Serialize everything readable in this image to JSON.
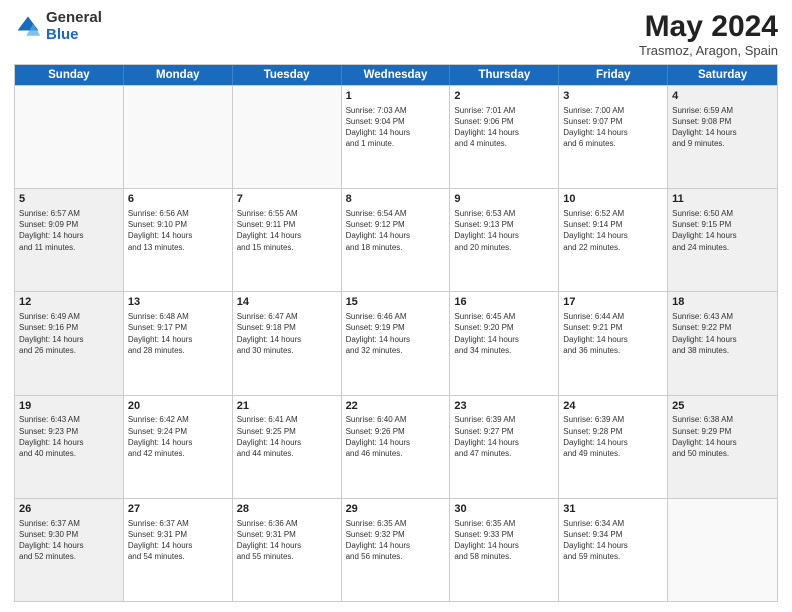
{
  "logo": {
    "general": "General",
    "blue": "Blue"
  },
  "header": {
    "month": "May 2024",
    "location": "Trasmoz, Aragon, Spain"
  },
  "days": [
    "Sunday",
    "Monday",
    "Tuesday",
    "Wednesday",
    "Thursday",
    "Friday",
    "Saturday"
  ],
  "weeks": [
    [
      {
        "day": "",
        "info": ""
      },
      {
        "day": "",
        "info": ""
      },
      {
        "day": "",
        "info": ""
      },
      {
        "day": "1",
        "info": "Sunrise: 7:03 AM\nSunset: 9:04 PM\nDaylight: 14 hours\nand 1 minute."
      },
      {
        "day": "2",
        "info": "Sunrise: 7:01 AM\nSunset: 9:06 PM\nDaylight: 14 hours\nand 4 minutes."
      },
      {
        "day": "3",
        "info": "Sunrise: 7:00 AM\nSunset: 9:07 PM\nDaylight: 14 hours\nand 6 minutes."
      },
      {
        "day": "4",
        "info": "Sunrise: 6:59 AM\nSunset: 9:08 PM\nDaylight: 14 hours\nand 9 minutes."
      }
    ],
    [
      {
        "day": "5",
        "info": "Sunrise: 6:57 AM\nSunset: 9:09 PM\nDaylight: 14 hours\nand 11 minutes."
      },
      {
        "day": "6",
        "info": "Sunrise: 6:56 AM\nSunset: 9:10 PM\nDaylight: 14 hours\nand 13 minutes."
      },
      {
        "day": "7",
        "info": "Sunrise: 6:55 AM\nSunset: 9:11 PM\nDaylight: 14 hours\nand 15 minutes."
      },
      {
        "day": "8",
        "info": "Sunrise: 6:54 AM\nSunset: 9:12 PM\nDaylight: 14 hours\nand 18 minutes."
      },
      {
        "day": "9",
        "info": "Sunrise: 6:53 AM\nSunset: 9:13 PM\nDaylight: 14 hours\nand 20 minutes."
      },
      {
        "day": "10",
        "info": "Sunrise: 6:52 AM\nSunset: 9:14 PM\nDaylight: 14 hours\nand 22 minutes."
      },
      {
        "day": "11",
        "info": "Sunrise: 6:50 AM\nSunset: 9:15 PM\nDaylight: 14 hours\nand 24 minutes."
      }
    ],
    [
      {
        "day": "12",
        "info": "Sunrise: 6:49 AM\nSunset: 9:16 PM\nDaylight: 14 hours\nand 26 minutes."
      },
      {
        "day": "13",
        "info": "Sunrise: 6:48 AM\nSunset: 9:17 PM\nDaylight: 14 hours\nand 28 minutes."
      },
      {
        "day": "14",
        "info": "Sunrise: 6:47 AM\nSunset: 9:18 PM\nDaylight: 14 hours\nand 30 minutes."
      },
      {
        "day": "15",
        "info": "Sunrise: 6:46 AM\nSunset: 9:19 PM\nDaylight: 14 hours\nand 32 minutes."
      },
      {
        "day": "16",
        "info": "Sunrise: 6:45 AM\nSunset: 9:20 PM\nDaylight: 14 hours\nand 34 minutes."
      },
      {
        "day": "17",
        "info": "Sunrise: 6:44 AM\nSunset: 9:21 PM\nDaylight: 14 hours\nand 36 minutes."
      },
      {
        "day": "18",
        "info": "Sunrise: 6:43 AM\nSunset: 9:22 PM\nDaylight: 14 hours\nand 38 minutes."
      }
    ],
    [
      {
        "day": "19",
        "info": "Sunrise: 6:43 AM\nSunset: 9:23 PM\nDaylight: 14 hours\nand 40 minutes."
      },
      {
        "day": "20",
        "info": "Sunrise: 6:42 AM\nSunset: 9:24 PM\nDaylight: 14 hours\nand 42 minutes."
      },
      {
        "day": "21",
        "info": "Sunrise: 6:41 AM\nSunset: 9:25 PM\nDaylight: 14 hours\nand 44 minutes."
      },
      {
        "day": "22",
        "info": "Sunrise: 6:40 AM\nSunset: 9:26 PM\nDaylight: 14 hours\nand 46 minutes."
      },
      {
        "day": "23",
        "info": "Sunrise: 6:39 AM\nSunset: 9:27 PM\nDaylight: 14 hours\nand 47 minutes."
      },
      {
        "day": "24",
        "info": "Sunrise: 6:39 AM\nSunset: 9:28 PM\nDaylight: 14 hours\nand 49 minutes."
      },
      {
        "day": "25",
        "info": "Sunrise: 6:38 AM\nSunset: 9:29 PM\nDaylight: 14 hours\nand 50 minutes."
      }
    ],
    [
      {
        "day": "26",
        "info": "Sunrise: 6:37 AM\nSunset: 9:30 PM\nDaylight: 14 hours\nand 52 minutes."
      },
      {
        "day": "27",
        "info": "Sunrise: 6:37 AM\nSunset: 9:31 PM\nDaylight: 14 hours\nand 54 minutes."
      },
      {
        "day": "28",
        "info": "Sunrise: 6:36 AM\nSunset: 9:31 PM\nDaylight: 14 hours\nand 55 minutes."
      },
      {
        "day": "29",
        "info": "Sunrise: 6:35 AM\nSunset: 9:32 PM\nDaylight: 14 hours\nand 56 minutes."
      },
      {
        "day": "30",
        "info": "Sunrise: 6:35 AM\nSunset: 9:33 PM\nDaylight: 14 hours\nand 58 minutes."
      },
      {
        "day": "31",
        "info": "Sunrise: 6:34 AM\nSunset: 9:34 PM\nDaylight: 14 hours\nand 59 minutes."
      },
      {
        "day": "",
        "info": ""
      }
    ]
  ]
}
